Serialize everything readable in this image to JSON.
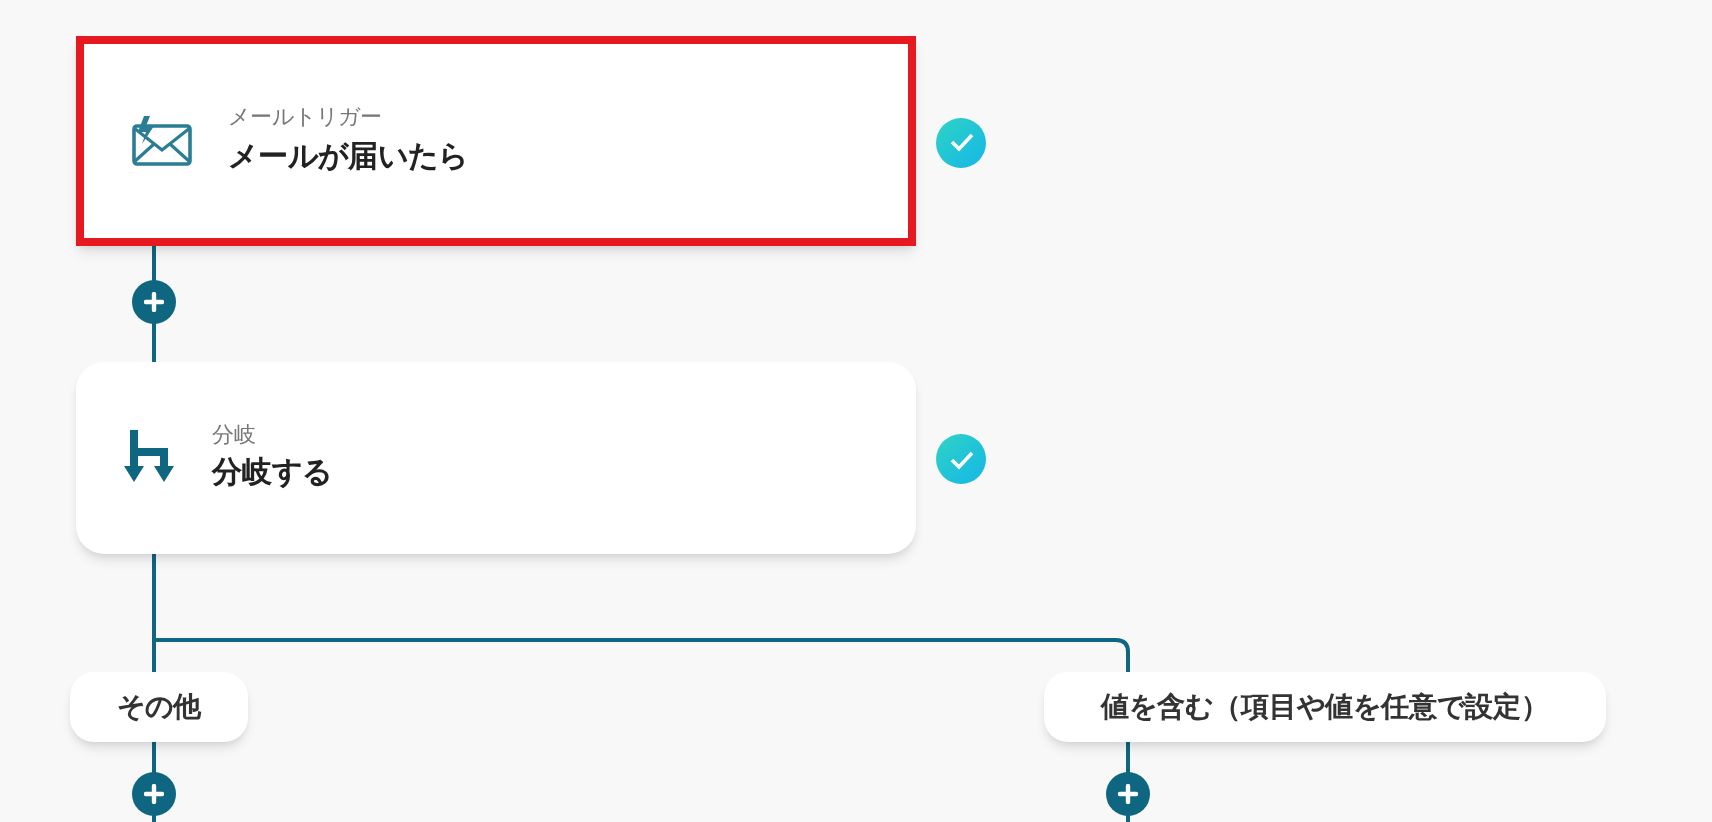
{
  "steps": [
    {
      "kind": "mail",
      "label": "メールトリガー",
      "title": "メールが届いたら",
      "highlighted": true,
      "done": true
    },
    {
      "kind": "branch",
      "label": "分岐",
      "title": "分岐する",
      "highlighted": false,
      "done": true
    }
  ],
  "branches": [
    {
      "label": "その他"
    },
    {
      "label": "値を含む（項目や値を任意で設定）"
    }
  ]
}
